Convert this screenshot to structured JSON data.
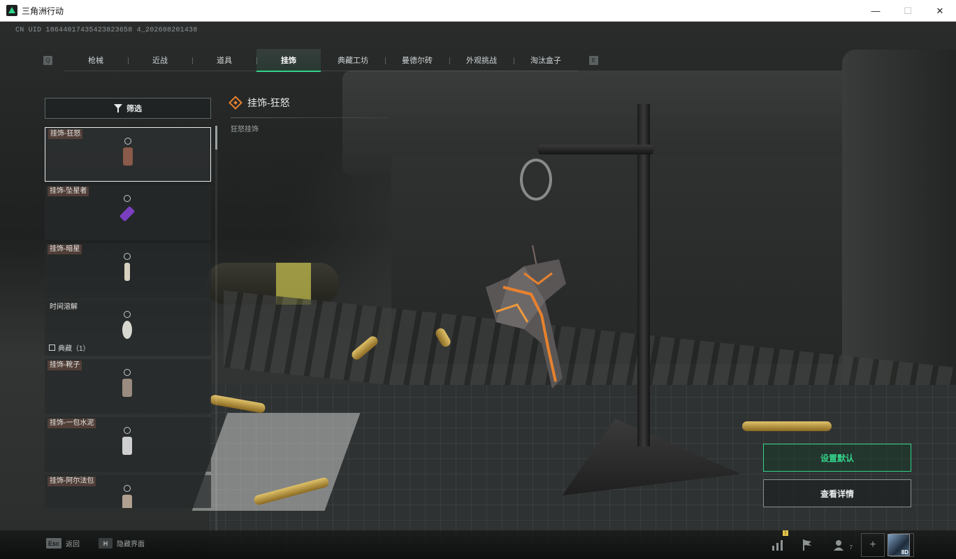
{
  "window": {
    "title": "三角洲行动",
    "controls": {
      "minimize": "—",
      "maximize": "☐",
      "close": "✕"
    }
  },
  "uid_text": "CN UID 18644017435423823658 4_202608201438",
  "tabs": {
    "prev_key": "Q",
    "next_key": "E",
    "items": [
      "枪械",
      "近战",
      "道具",
      "挂饰",
      "典藏工坊",
      "曼德尔砖",
      "外观挑战",
      "淘汰盒子"
    ],
    "active": "挂饰"
  },
  "filter": {
    "label": "筛选"
  },
  "items": [
    {
      "label": "挂饰-狂怒",
      "selected": true,
      "color": "#8a5a4a"
    },
    {
      "label": "挂饰-坠星者",
      "selected": false,
      "color": "#7a3fc0"
    },
    {
      "label": "挂饰-暗星",
      "selected": false,
      "color": "#d8d0c0"
    },
    {
      "label": "时间溶解",
      "selected": false,
      "color": "#d8d8d0",
      "collection": "典藏（1）"
    },
    {
      "label": "挂饰-靴子",
      "selected": false,
      "color": "#9a8c80"
    },
    {
      "label": "挂饰-一包水泥",
      "selected": false,
      "color": "#cfcfcf"
    },
    {
      "label": "挂饰-阿尔法包",
      "selected": false,
      "color": "#b0a090"
    }
  ],
  "detail": {
    "title": "挂饰-狂怒",
    "subtitle": "狂怒挂饰"
  },
  "actions": {
    "set_default": "设置默认",
    "view_details": "查看详情"
  },
  "bottom": {
    "back_key": "Esc",
    "back_label": "返回",
    "hide_key": "H",
    "hide_label": "隐藏界面",
    "stats_badge": "!",
    "friends_count": "7",
    "avatar_level": "8D"
  },
  "colors": {
    "accent": "#34d48a",
    "charm_glow": "#e7822e"
  }
}
